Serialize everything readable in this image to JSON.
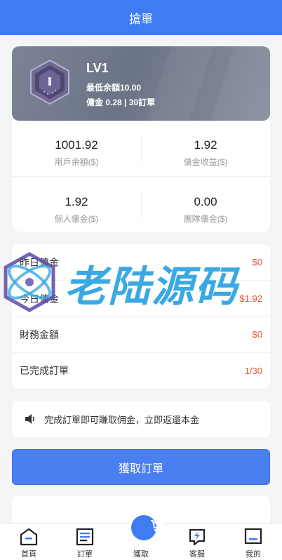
{
  "header": {
    "title": "搶單"
  },
  "level": {
    "name": "LV1",
    "min_balance": "最低余額10.00",
    "commission_info": "傭金 0.28 | 30訂單",
    "badge_icon": "hexagon-rank-badge-icon"
  },
  "stats": [
    {
      "value": "1001.92",
      "label": "用戶余額($)"
    },
    {
      "value": "1.92",
      "label": "傭金收益($)"
    },
    {
      "value": "1.92",
      "label": "個人傭金($)"
    },
    {
      "value": "0.00",
      "label": "團隊傭金($)"
    }
  ],
  "rows": [
    {
      "label": "昨日傭金",
      "value": "$0"
    },
    {
      "label": "今日傭金",
      "value": "$1.92"
    },
    {
      "label": "財務金額",
      "value": "$0"
    },
    {
      "label": "已完成訂單",
      "value": "1/30"
    }
  ],
  "notice": {
    "text": "完成訂單即可賺取佣金，立即返還本金",
    "icon": "speaker-icon"
  },
  "action_button": {
    "label": "獲取訂單"
  },
  "watermark": {
    "text": "老陆源码"
  },
  "tabs": [
    {
      "label": "首頁",
      "icon": "home-icon"
    },
    {
      "label": "訂單",
      "icon": "list-icon"
    },
    {
      "label": "獲取",
      "icon": "cart-icon"
    },
    {
      "label": "客服",
      "icon": "service-icon"
    },
    {
      "label": "我的",
      "icon": "profile-icon"
    }
  ],
  "colors": {
    "primary": "#3f7cf2",
    "accent_red": "#e2543b",
    "watermark": "#3aa9e3"
  }
}
